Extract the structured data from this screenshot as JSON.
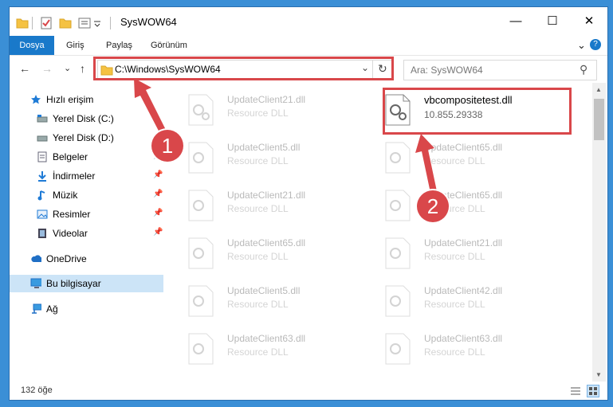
{
  "window": {
    "title": "SysWOW64",
    "minimize": "—",
    "maximize": "☐",
    "close": "✕"
  },
  "ribbon": {
    "tabs": [
      "Dosya",
      "Giriş",
      "Paylaş",
      "Görünüm"
    ],
    "expand": "⌄",
    "help": "?"
  },
  "nav": {
    "back": "←",
    "forward": "→",
    "recent": "⌄",
    "up": "↑",
    "address": "C:\\Windows\\SysWOW64",
    "dropdown": "⌄",
    "refresh": "↻",
    "search_placeholder": "Ara: SysWOW64",
    "search_icon": "⚲"
  },
  "sidebar": {
    "items": [
      {
        "label": "Hızlı erişim"
      },
      {
        "label": "Yerel Disk (C:)"
      },
      {
        "label": "Yerel Disk (D:)"
      },
      {
        "label": "Belgeler",
        "pin": "📌"
      },
      {
        "label": "İndirmeler",
        "pin": "📌"
      },
      {
        "label": "Müzik",
        "pin": "📌"
      },
      {
        "label": "Resimler",
        "pin": "📌"
      },
      {
        "label": "Videolar",
        "pin": "📌"
      },
      {
        "label": "OneDrive"
      },
      {
        "label": "Bu bilgisayar"
      },
      {
        "label": "Ağ"
      }
    ]
  },
  "files": [
    {
      "name": "UpdateClient21.dll",
      "desc": "Resource DLL"
    },
    {
      "name": "vbcompositetest.dll",
      "desc": "10.855.29338"
    },
    {
      "name": "UpdateClient5.dll",
      "desc": "Resource DLL"
    },
    {
      "name": "UpdateClient65.dll",
      "desc": "Resource DLL"
    },
    {
      "name": "UpdateClient21.dll",
      "desc": "Resource DLL"
    },
    {
      "name": "UpdateClient65.dll",
      "desc": "Resource DLL"
    },
    {
      "name": "UpdateClient65.dll",
      "desc": "Resource DLL"
    },
    {
      "name": "UpdateClient21.dll",
      "desc": "Resource DLL"
    },
    {
      "name": "UpdateClient5.dll",
      "desc": "Resource DLL"
    },
    {
      "name": "UpdateClient42.dll",
      "desc": "Resource DLL"
    },
    {
      "name": "UpdateClient63.dll",
      "desc": "Resource DLL"
    },
    {
      "name": "UpdateClient63.dll",
      "desc": "Resource DLL"
    }
  ],
  "status": {
    "count": "132 öğe"
  },
  "annotations": {
    "step1": "1",
    "step2": "2",
    "color": "#d9474a"
  },
  "colors": {
    "accent": "#1979ca",
    "selection": "#cce4f7",
    "folder": "#f5c242"
  }
}
